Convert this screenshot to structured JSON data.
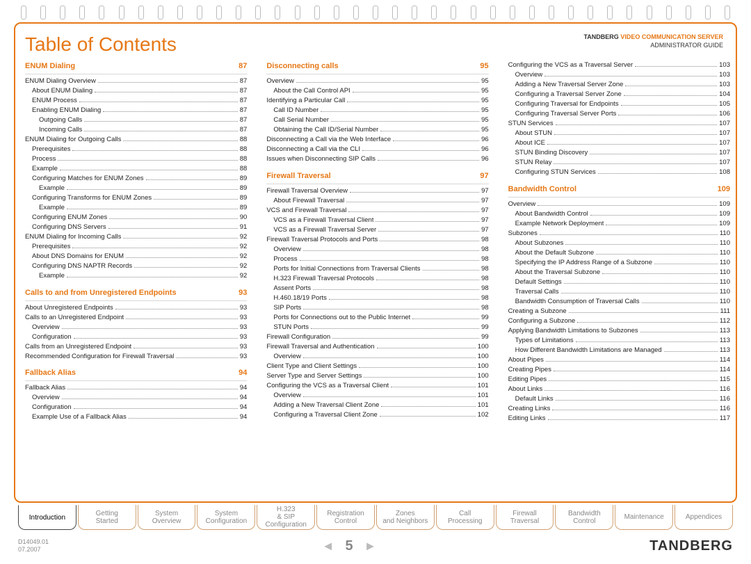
{
  "header": {
    "title": "Table of Contents",
    "brand": "TANDBERG",
    "product": "VIDEO COMMUNICATION SERVER",
    "subtitle": "ADMINISTRATOR GUIDE"
  },
  "sections": {
    "col1": [
      {
        "type": "head",
        "label": "ENUM Dialing",
        "page": "87"
      },
      {
        "type": "entry",
        "indent": 0,
        "label": "ENUM Dialing Overview",
        "page": "87"
      },
      {
        "type": "entry",
        "indent": 1,
        "label": "About ENUM Dialing",
        "page": "87"
      },
      {
        "type": "entry",
        "indent": 1,
        "label": "ENUM Process",
        "page": "87"
      },
      {
        "type": "entry",
        "indent": 1,
        "label": "Enabling ENUM Dialing",
        "page": "87"
      },
      {
        "type": "entry",
        "indent": 2,
        "label": "Outgoing Calls",
        "page": "87"
      },
      {
        "type": "entry",
        "indent": 2,
        "label": "Incoming Calls",
        "page": "87"
      },
      {
        "type": "entry",
        "indent": 0,
        "label": "ENUM Dialing for Outgoing Calls",
        "page": "88"
      },
      {
        "type": "entry",
        "indent": 1,
        "label": "Prerequisites",
        "page": "88"
      },
      {
        "type": "entry",
        "indent": 1,
        "label": "Process",
        "page": "88"
      },
      {
        "type": "entry",
        "indent": 1,
        "label": "Example",
        "page": "88"
      },
      {
        "type": "entry",
        "indent": 1,
        "label": "Configuring Matches for ENUM Zones",
        "page": "89"
      },
      {
        "type": "entry",
        "indent": 2,
        "label": "Example",
        "page": "89"
      },
      {
        "type": "entry",
        "indent": 1,
        "label": "Configuring Transforms for ENUM Zones",
        "page": "89"
      },
      {
        "type": "entry",
        "indent": 2,
        "label": "Example",
        "page": "89"
      },
      {
        "type": "entry",
        "indent": 1,
        "label": "Configuring ENUM Zones",
        "page": "90"
      },
      {
        "type": "entry",
        "indent": 1,
        "label": "Configuring DNS Servers",
        "page": "91"
      },
      {
        "type": "entry",
        "indent": 0,
        "label": "ENUM Dialing for Incoming Calls",
        "page": "92"
      },
      {
        "type": "entry",
        "indent": 1,
        "label": "Prerequisites",
        "page": "92"
      },
      {
        "type": "entry",
        "indent": 1,
        "label": "About DNS Domains for ENUM",
        "page": "92"
      },
      {
        "type": "entry",
        "indent": 1,
        "label": "Configuring DNS NAPTR Records",
        "page": "92"
      },
      {
        "type": "entry",
        "indent": 2,
        "label": "Example",
        "page": "92"
      },
      {
        "type": "head",
        "label": "Calls to and from Unregistered Endpoints",
        "page": "93"
      },
      {
        "type": "entry",
        "indent": 0,
        "label": "About Unregistered Endpoints",
        "page": "93"
      },
      {
        "type": "entry",
        "indent": 0,
        "label": "Calls to an Unregistered Endpoint",
        "page": "93"
      },
      {
        "type": "entry",
        "indent": 1,
        "label": "Overview",
        "page": "93"
      },
      {
        "type": "entry",
        "indent": 1,
        "label": "Configuration",
        "page": "93"
      },
      {
        "type": "entry",
        "indent": 0,
        "label": "Calls from an Unregistered Endpoint",
        "page": "93"
      },
      {
        "type": "entry",
        "indent": 0,
        "label": "Recommended Configuration for Firewall Traversal",
        "page": "93"
      },
      {
        "type": "head",
        "label": "Fallback Alias",
        "page": "94"
      },
      {
        "type": "entry",
        "indent": 0,
        "label": "Fallback Alias",
        "page": "94"
      },
      {
        "type": "entry",
        "indent": 1,
        "label": "Overview",
        "page": "94"
      },
      {
        "type": "entry",
        "indent": 1,
        "label": "Configuration",
        "page": "94"
      },
      {
        "type": "entry",
        "indent": 1,
        "label": "Example Use of a Fallback Alias",
        "page": "94"
      }
    ],
    "col2": [
      {
        "type": "head",
        "label": "Disconnecting calls",
        "page": "95"
      },
      {
        "type": "entry",
        "indent": 0,
        "label": "Overview",
        "page": "95"
      },
      {
        "type": "entry",
        "indent": 1,
        "label": "About the Call Control API",
        "page": "95"
      },
      {
        "type": "entry",
        "indent": 0,
        "label": "Identifying a Particular Call",
        "page": "95"
      },
      {
        "type": "entry",
        "indent": 1,
        "label": "Call ID Number",
        "page": "95"
      },
      {
        "type": "entry",
        "indent": 1,
        "label": "Call Serial Number",
        "page": "95"
      },
      {
        "type": "entry",
        "indent": 1,
        "label": "Obtaining the Call ID/Serial Number",
        "page": "95"
      },
      {
        "type": "entry",
        "indent": 0,
        "label": "Disconnecting a Call via the Web Interface",
        "page": "96"
      },
      {
        "type": "entry",
        "indent": 0,
        "label": "Disconnecting a Call via the CLI",
        "page": "96"
      },
      {
        "type": "entry",
        "indent": 0,
        "label": "Issues when Disconnecting SIP Calls",
        "page": "96"
      },
      {
        "type": "head",
        "label": "Firewall Traversal",
        "page": "97"
      },
      {
        "type": "entry",
        "indent": 0,
        "label": "Firewall Traversal Overview",
        "page": "97"
      },
      {
        "type": "entry",
        "indent": 1,
        "label": "About Firewall Traversal",
        "page": "97"
      },
      {
        "type": "entry",
        "indent": 0,
        "label": "VCS and Firewall Traversal",
        "page": "97"
      },
      {
        "type": "entry",
        "indent": 1,
        "label": "VCS as a Firewall Traversal Client",
        "page": "97"
      },
      {
        "type": "entry",
        "indent": 1,
        "label": "VCS as a Firewall Traversal Server",
        "page": "97"
      },
      {
        "type": "entry",
        "indent": 0,
        "label": "Firewall Traversal Protocols and Ports",
        "page": "98"
      },
      {
        "type": "entry",
        "indent": 1,
        "label": "Overview",
        "page": "98"
      },
      {
        "type": "entry",
        "indent": 1,
        "label": "Process",
        "page": "98"
      },
      {
        "type": "entry",
        "indent": 1,
        "label": "Ports for Initial Connections from Traversal Clients",
        "page": "98"
      },
      {
        "type": "entry",
        "indent": 1,
        "label": "H.323 Firewall Traversal Protocols",
        "page": "98"
      },
      {
        "type": "entry",
        "indent": 1,
        "label": "Assent Ports",
        "page": "98"
      },
      {
        "type": "entry",
        "indent": 1,
        "label": "H.460.18/19 Ports",
        "page": "98"
      },
      {
        "type": "entry",
        "indent": 1,
        "label": "SIP Ports",
        "page": "98"
      },
      {
        "type": "entry",
        "indent": 1,
        "label": "Ports for Connections out to the Public Internet",
        "page": "99"
      },
      {
        "type": "entry",
        "indent": 1,
        "label": "STUN Ports",
        "page": "99"
      },
      {
        "type": "entry",
        "indent": 0,
        "label": "Firewall Configuration",
        "page": "99"
      },
      {
        "type": "entry",
        "indent": 0,
        "label": "Firewall Traversal and Authentication",
        "page": "100"
      },
      {
        "type": "entry",
        "indent": 1,
        "label": "Overview",
        "page": "100"
      },
      {
        "type": "entry",
        "indent": 0,
        "label": "Client Type and Client Settings",
        "page": "100"
      },
      {
        "type": "entry",
        "indent": 0,
        "label": "Server Type and Server Settings",
        "page": "100"
      },
      {
        "type": "entry",
        "indent": 0,
        "label": "Configuring the VCS as a Traversal Client",
        "page": "101"
      },
      {
        "type": "entry",
        "indent": 1,
        "label": "Overview",
        "page": "101"
      },
      {
        "type": "entry",
        "indent": 1,
        "label": "Adding a New Traversal Client Zone",
        "page": "101"
      },
      {
        "type": "entry",
        "indent": 1,
        "label": "Configuring a Traversal Client Zone",
        "page": "102"
      }
    ],
    "col3": [
      {
        "type": "entry",
        "indent": 0,
        "label": "Configuring the VCS as a Traversal Server",
        "page": "103"
      },
      {
        "type": "entry",
        "indent": 1,
        "label": "Overview",
        "page": "103"
      },
      {
        "type": "entry",
        "indent": 1,
        "label": "Adding a New Traversal Server Zone",
        "page": "103"
      },
      {
        "type": "entry",
        "indent": 1,
        "label": "Configuring a Traversal Server Zone",
        "page": "104"
      },
      {
        "type": "entry",
        "indent": 1,
        "label": "Configuring Traversal for Endpoints",
        "page": "105"
      },
      {
        "type": "entry",
        "indent": 1,
        "label": "Configuring Traversal Server Ports",
        "page": "106"
      },
      {
        "type": "entry",
        "indent": 0,
        "label": "STUN Services",
        "page": "107"
      },
      {
        "type": "entry",
        "indent": 1,
        "label": "About STUN",
        "page": "107"
      },
      {
        "type": "entry",
        "indent": 1,
        "label": "About ICE",
        "page": "107"
      },
      {
        "type": "entry",
        "indent": 1,
        "label": "STUN Binding Discovery",
        "page": "107"
      },
      {
        "type": "entry",
        "indent": 1,
        "label": "STUN Relay",
        "page": "107"
      },
      {
        "type": "entry",
        "indent": 1,
        "label": "Configuring STUN Services",
        "page": "108"
      },
      {
        "type": "head",
        "label": "Bandwidth Control",
        "page": "109"
      },
      {
        "type": "entry",
        "indent": 0,
        "label": "Overview",
        "page": "109"
      },
      {
        "type": "entry",
        "indent": 1,
        "label": "About Bandwidth Control",
        "page": "109"
      },
      {
        "type": "entry",
        "indent": 1,
        "label": "Example Network Deployment",
        "page": "109"
      },
      {
        "type": "entry",
        "indent": 0,
        "label": "Subzones",
        "page": "110"
      },
      {
        "type": "entry",
        "indent": 1,
        "label": "About Subzones",
        "page": "110"
      },
      {
        "type": "entry",
        "indent": 1,
        "label": "About the Default Subzone",
        "page": "110"
      },
      {
        "type": "entry",
        "indent": 1,
        "label": "Specifying the IP Address Range of a Subzone",
        "page": "110"
      },
      {
        "type": "entry",
        "indent": 1,
        "label": "About the Traversal Subzone",
        "page": "110"
      },
      {
        "type": "entry",
        "indent": 1,
        "label": "Default Settings",
        "page": "110"
      },
      {
        "type": "entry",
        "indent": 1,
        "label": "Traversal Calls",
        "page": "110"
      },
      {
        "type": "entry",
        "indent": 1,
        "label": "Bandwidth Consumption of Traversal Calls",
        "page": "110"
      },
      {
        "type": "entry",
        "indent": 0,
        "label": "Creating a Subzone",
        "page": "111"
      },
      {
        "type": "entry",
        "indent": 0,
        "label": "Configuring a Subzone",
        "page": "112"
      },
      {
        "type": "entry",
        "indent": 0,
        "label": "Applying Bandwidth Limitations to Subzones",
        "page": "113"
      },
      {
        "type": "entry",
        "indent": 1,
        "label": "Types of Limitations",
        "page": "113"
      },
      {
        "type": "entry",
        "indent": 1,
        "label": "How Different Bandwidth Limitations are Managed",
        "page": "113"
      },
      {
        "type": "entry",
        "indent": 0,
        "label": "About Pipes",
        "page": "114"
      },
      {
        "type": "entry",
        "indent": 0,
        "label": "Creating Pipes",
        "page": "114"
      },
      {
        "type": "entry",
        "indent": 0,
        "label": "Editing Pipes",
        "page": "115"
      },
      {
        "type": "entry",
        "indent": 0,
        "label": "About Links",
        "page": "116"
      },
      {
        "type": "entry",
        "indent": 1,
        "label": "Default Links",
        "page": "116"
      },
      {
        "type": "entry",
        "indent": 0,
        "label": "Creating Links",
        "page": "116"
      },
      {
        "type": "entry",
        "indent": 0,
        "label": "Editing Links",
        "page": "117"
      }
    ]
  },
  "tabs": [
    {
      "label": "Introduction",
      "active": true
    },
    {
      "label": "Getting Started",
      "active": false
    },
    {
      "label": "System Overview",
      "active": false
    },
    {
      "label": "System Configuration",
      "active": false
    },
    {
      "label": "H.323 & SIP Configuration",
      "active": false
    },
    {
      "label": "Registration Control",
      "active": false
    },
    {
      "label": "Zones and Neighbors",
      "active": false
    },
    {
      "label": "Call Processing",
      "active": false
    },
    {
      "label": "Firewall Traversal",
      "active": false
    },
    {
      "label": "Bandwidth Control",
      "active": false
    },
    {
      "label": "Maintenance",
      "active": false
    },
    {
      "label": "Appendices",
      "active": false
    }
  ],
  "footer": {
    "doc_id": "D14049.01",
    "date": "07.2007",
    "page_number": "5",
    "brand": "TANDBERG"
  }
}
